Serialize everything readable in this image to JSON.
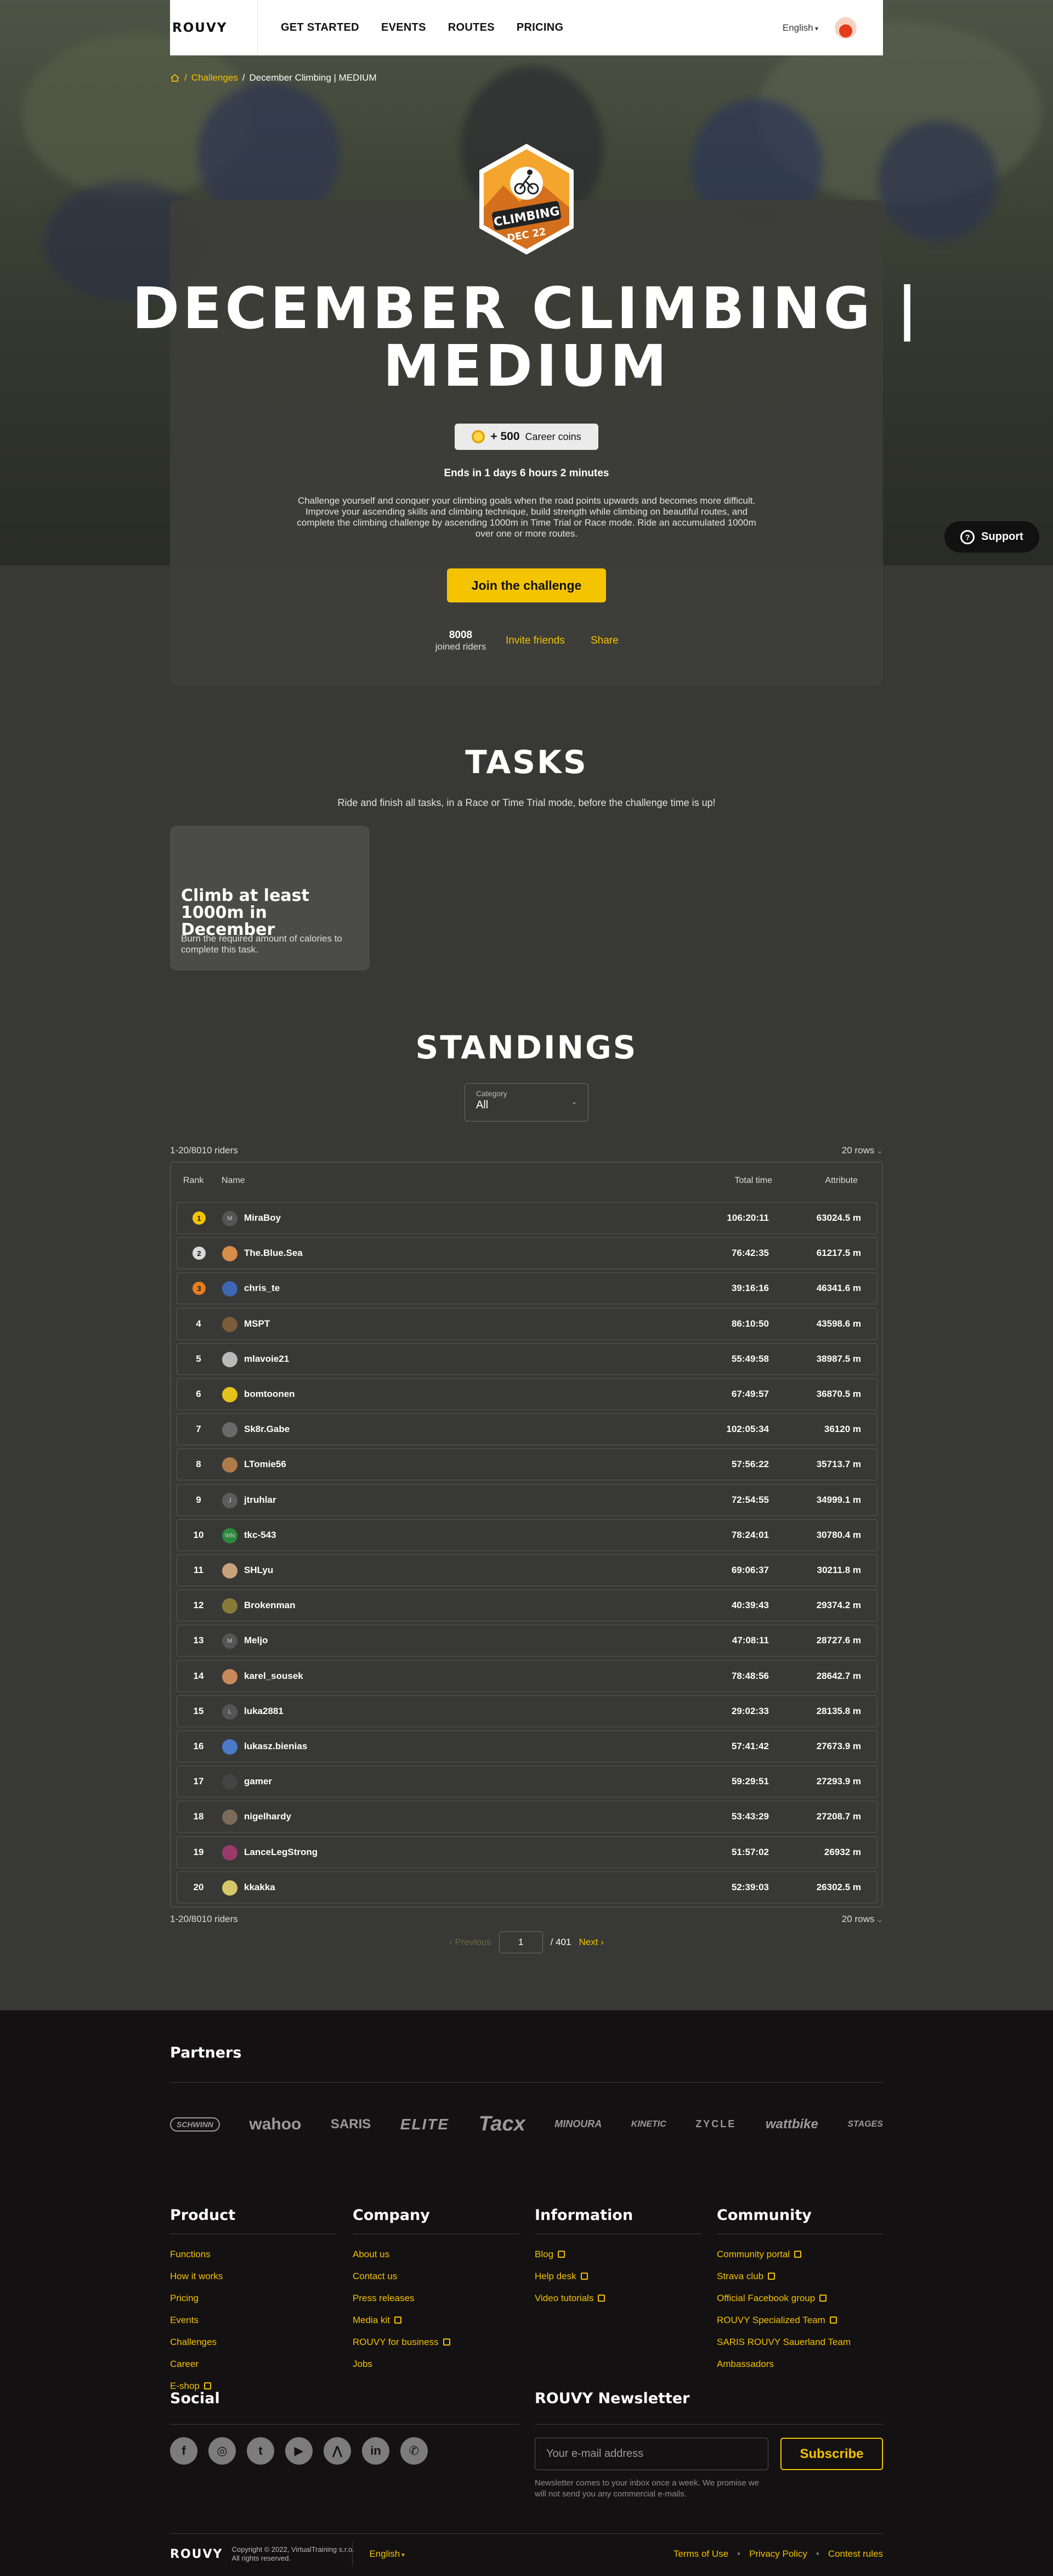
{
  "header": {
    "logo": "ROUVY",
    "nav": [
      "GET STARTED",
      "EVENTS",
      "ROUTES",
      "PRICING"
    ],
    "language": "English"
  },
  "breadcrumb": {
    "challenges": "Challenges",
    "separator": "/",
    "current": "December Climbing | MEDIUM"
  },
  "badge": {
    "line1": "CLIMBING",
    "line2": "DEC 22"
  },
  "hero": {
    "title": "DECEMBER CLIMBING | MEDIUM",
    "coins_amount": "+ 500",
    "coins_label": "Career coins",
    "ends_prefix": "Ends in",
    "ends_days": "1",
    "ends_days_label": "days",
    "ends_hours": "6",
    "ends_hours_label": "hours",
    "ends_minutes": "2",
    "ends_minutes_label": "minutes",
    "description": "Challenge yourself and conquer your climbing goals when the road points upwards and becomes more difficult. Improve your ascending skills and climbing technique, build strength while climbing on beautiful routes, and complete the climbing challenge by ascending 1000m in Time Trial or Race mode. Ride an accumulated 1000m over one or more routes.",
    "join_label": "Join the challenge",
    "joined_count": "8008",
    "joined_label": "joined riders",
    "invite_label": "Invite friends",
    "share_label": "Share"
  },
  "support_label": "Support",
  "tasks": {
    "title": "TASKS",
    "subtitle": "Ride and finish all tasks, in a Race or Time Trial mode, before the challenge time is up!",
    "items": [
      {
        "title": "Climb at least 1000m in December",
        "text": "Burn the required amount of calories to complete this task."
      }
    ]
  },
  "standings": {
    "title": "STANDINGS",
    "category_label": "Category",
    "category_value": "All",
    "count_text": "1-20/8010 riders",
    "rows_label": "20 rows",
    "columns": {
      "rank": "Rank",
      "name": "Name",
      "time": "Total time",
      "attribute": "Attribute"
    },
    "rows": [
      {
        "rank": "1",
        "initial": "M",
        "name": "MiraBoy",
        "time": "106:20:11",
        "attribute": "63024.5 m"
      },
      {
        "rank": "2",
        "initial": "",
        "name": "The.Blue.Sea",
        "time": "76:42:35",
        "attribute": "61217.5 m"
      },
      {
        "rank": "3",
        "initial": "",
        "name": "chris_te",
        "time": "39:16:16",
        "attribute": "46341.6 m"
      },
      {
        "rank": "4",
        "initial": "",
        "name": "MSPT",
        "time": "86:10:50",
        "attribute": "43598.6 m"
      },
      {
        "rank": "5",
        "initial": "",
        "name": "mlavoie21",
        "time": "55:49:58",
        "attribute": "38987.5 m"
      },
      {
        "rank": "6",
        "initial": "",
        "name": "bomtoonen",
        "time": "67:49:57",
        "attribute": "36870.5 m"
      },
      {
        "rank": "7",
        "initial": "",
        "name": "Sk8r.Gabe",
        "time": "102:05:34",
        "attribute": "36120 m"
      },
      {
        "rank": "8",
        "initial": "",
        "name": "LTomie56",
        "time": "57:56:22",
        "attribute": "35713.7 m"
      },
      {
        "rank": "9",
        "initial": "J",
        "name": "jtruhlar",
        "time": "72:54:55",
        "attribute": "34999.1 m"
      },
      {
        "rank": "10",
        "initial": "WN",
        "name": "tkc-543",
        "time": "78:24:01",
        "attribute": "30780.4 m"
      },
      {
        "rank": "11",
        "initial": "",
        "name": "SHLyu",
        "time": "69:06:37",
        "attribute": "30211.8 m"
      },
      {
        "rank": "12",
        "initial": "",
        "name": "Brokenman",
        "time": "40:39:43",
        "attribute": "29374.2 m"
      },
      {
        "rank": "13",
        "initial": "M",
        "name": "Meljo",
        "time": "47:08:11",
        "attribute": "28727.6 m"
      },
      {
        "rank": "14",
        "initial": "",
        "name": "karel_sousek",
        "time": "78:48:56",
        "attribute": "28642.7 m"
      },
      {
        "rank": "15",
        "initial": "L",
        "name": "luka2881",
        "time": "29:02:33",
        "attribute": "28135.8 m"
      },
      {
        "rank": "16",
        "initial": "",
        "name": "lukasz.bienias",
        "time": "57:41:42",
        "attribute": "27673.9 m"
      },
      {
        "rank": "17",
        "initial": "",
        "name": "gamer",
        "time": "59:29:51",
        "attribute": "27293.9 m"
      },
      {
        "rank": "18",
        "initial": "",
        "name": "nigelhardy",
        "time": "53:43:29",
        "attribute": "27208.7 m"
      },
      {
        "rank": "19",
        "initial": "",
        "name": "LanceLegStrong",
        "time": "51:57:02",
        "attribute": "26932 m"
      },
      {
        "rank": "20",
        "initial": "",
        "name": "kkakka",
        "time": "52:39:03",
        "attribute": "26302.5 m"
      }
    ],
    "pager": {
      "prev": "Previous",
      "page": "1",
      "total": "/ 401",
      "next": "Next"
    }
  },
  "footer": {
    "partners_title": "Partners",
    "partners": [
      "SCHWINN",
      "wahoo",
      "SARIS",
      "ELITE",
      "Tacx",
      "MINOURA",
      "KINETIC",
      "ZYCLE",
      "wattbike",
      "STAGES"
    ],
    "product": {
      "title": "Product",
      "links": [
        "Functions",
        "How it works",
        "Pricing",
        "Events",
        "Challenges",
        "Career",
        "E-shop"
      ]
    },
    "company": {
      "title": "Company",
      "links": [
        "About us",
        "Contact us",
        "Press releases",
        "Media kit",
        "ROUVY for business",
        "Jobs"
      ]
    },
    "information": {
      "title": "Information",
      "links": [
        "Blog",
        "Help desk",
        "Video tutorials"
      ]
    },
    "community": {
      "title": "Community",
      "links": [
        "Community portal",
        "Strava club",
        "Official Facebook group",
        "ROUVY Specialized Team",
        "SARIS ROUVY Sauerland Team",
        "Ambassadors"
      ]
    },
    "social_title": "Social",
    "socials": [
      "f",
      "◎",
      "t",
      "▶",
      "⋀",
      "in",
      "✆"
    ],
    "newsletter_title": "ROUVY Newsletter",
    "email_placeholder": "Your e-mail address",
    "subscribe_label": "Subscribe",
    "newsletter_note": "Newsletter comes to your inbox once a week. We promise we will not send you any commercial e-mails.",
    "bottom_logo": "ROUVY",
    "copyright_1": "Copyright © 2022, VirtualTraining s.r.o.",
    "copyright_2": "All rights reserved.",
    "language": "English",
    "legal": [
      "Terms of Use",
      "Privacy Policy",
      "Contest rules"
    ]
  },
  "colors": {
    "accent": "#f5c400",
    "bg": "#383836",
    "footer": "#141112"
  }
}
